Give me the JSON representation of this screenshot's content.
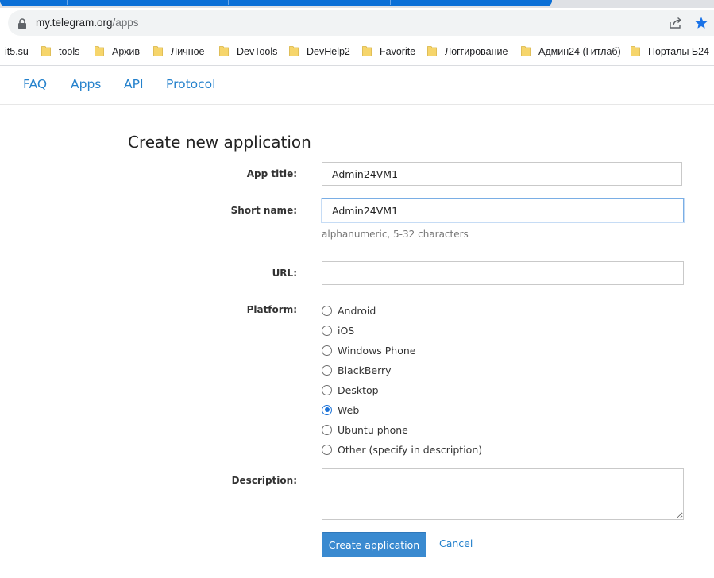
{
  "browser": {
    "url_host": "my.telegram.org",
    "url_path": "/apps",
    "bookmarks": [
      "it5.su",
      "tools",
      "Архив",
      "Личное",
      "DevTools",
      "DevHelp2",
      "Favorite",
      "Логгирование",
      "Админ24 (Гитлаб)",
      "Порталы Б24"
    ],
    "colors": {
      "active_tab": "#0b6fd6",
      "star": "#1a73e8",
      "folder": "#f6d56b"
    }
  },
  "nav": {
    "items": [
      "FAQ",
      "Apps",
      "API",
      "Protocol"
    ]
  },
  "form": {
    "heading": "Create new application",
    "app_title": {
      "label": "App title:",
      "value": "Admin24VM1"
    },
    "short_name": {
      "label": "Short name:",
      "value": "Admin24VM1",
      "hint": "alphanumeric, 5-32 characters"
    },
    "url": {
      "label": "URL:",
      "value": ""
    },
    "platform": {
      "label": "Platform:",
      "options": [
        "Android",
        "iOS",
        "Windows Phone",
        "BlackBerry",
        "Desktop",
        "Web",
        "Ubuntu phone",
        "Other (specify in description)"
      ],
      "selected": "Web"
    },
    "description": {
      "label": "Description:",
      "value": ""
    },
    "submit_label": "Create application",
    "cancel_label": "Cancel",
    "colors": {
      "link": "#2481cc",
      "button": "#3a8ad0"
    }
  }
}
